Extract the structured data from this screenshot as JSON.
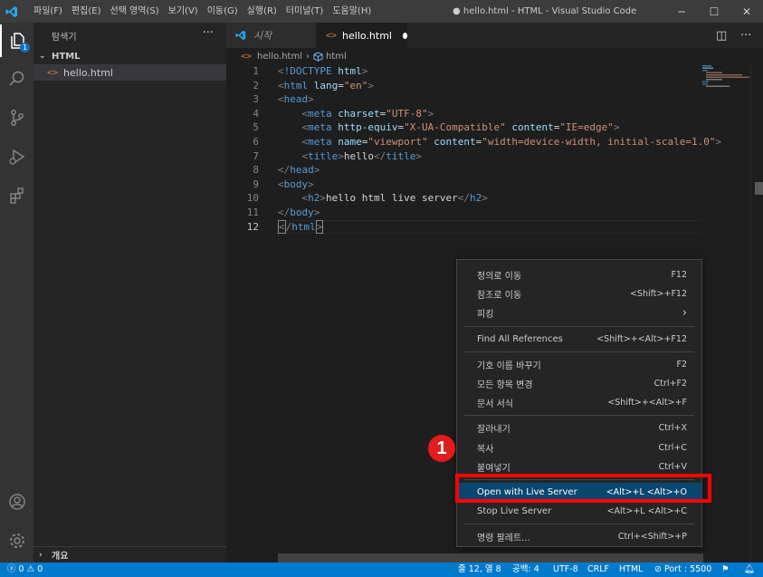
{
  "titlebar": {
    "menus": [
      "파일(F)",
      "편집(E)",
      "선택 영역(S)",
      "보기(V)",
      "이동(G)",
      "실행(R)",
      "터미널(T)",
      "도움말(H)"
    ],
    "window_title": "● hello.html - HTML - Visual Studio Code",
    "minimize": "─",
    "maximize": "☐",
    "close": "✕"
  },
  "activity_bar": {
    "explorer_badge": "1",
    "icons": [
      "files-icon",
      "search-icon",
      "source-control-icon",
      "run-debug-icon",
      "extensions-icon",
      "account-icon",
      "settings-gear-icon"
    ]
  },
  "sidebar": {
    "title": "탐색기",
    "more": "···",
    "folder": "HTML",
    "file": "hello.html",
    "outline": "개요"
  },
  "tabs": {
    "welcome": "시작",
    "active": "hello.html"
  },
  "breadcrumb": {
    "file": "hello.html",
    "symbol": "html"
  },
  "editor": {
    "current_line": 12
  },
  "context_menu": {
    "items": [
      {
        "label": "정의로 이동",
        "shortcut": "F12"
      },
      {
        "label": "참조로 이동",
        "shortcut": "<Shift>+F12"
      },
      {
        "label": "피킹",
        "shortcut": "›"
      },
      {
        "label": "Find All References",
        "shortcut": "<Shift>+<Alt>+F12"
      },
      {
        "label": "기호 이름 바꾸기",
        "shortcut": "F2"
      },
      {
        "label": "모든 항목 변경",
        "shortcut": "Ctrl+F2"
      },
      {
        "label": "문서 서식",
        "shortcut": "<Shift>+<Alt>+F"
      },
      {
        "label": "잘라내기",
        "shortcut": "Ctrl+X"
      },
      {
        "label": "복사",
        "shortcut": "Ctrl+C"
      },
      {
        "label": "붙여넣기",
        "shortcut": "Ctrl+V"
      },
      {
        "label": "Open with Live Server",
        "shortcut": "<Alt>+L <Alt>+O"
      },
      {
        "label": "Stop Live Server",
        "shortcut": "<Alt>+L <Alt>+C"
      },
      {
        "label": "명령 팔레트...",
        "shortcut": "Ctrl+<Shift>+P"
      }
    ]
  },
  "annotation": {
    "step": "1"
  },
  "statusbar": {
    "errors": "0",
    "warnings": "0",
    "position": "줄 12, 열 8",
    "spaces": "공백: 4",
    "encoding": "UTF-8",
    "eol": "CRLF",
    "language": "HTML",
    "port": "Port : 5500"
  },
  "colors": {
    "accent": "#007acc",
    "highlight_box": "#ff0000",
    "menu_selection": "#094771"
  }
}
